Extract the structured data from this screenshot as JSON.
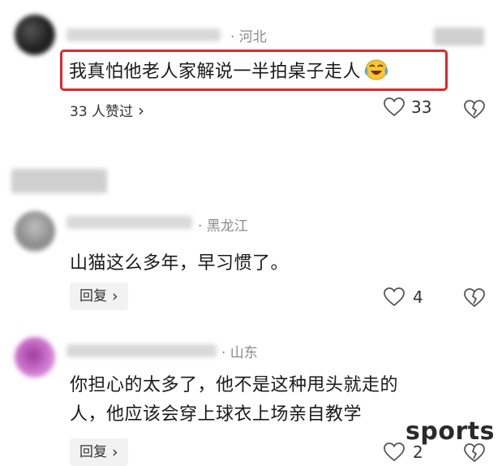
{
  "comments": [
    {
      "location": "· 河北",
      "text": "我真怕他老人家解说一半拍桌子走人",
      "emoji_icon": "laughing-crying-emoji-icon",
      "likers_label": "33 人赞过",
      "likers_chevron": "›",
      "like_count": "33",
      "highlight_color": "#e0262b"
    },
    {
      "location": "· 黑龙江",
      "text": "山猫这么多年，早习惯了。",
      "reply_label": "回复",
      "reply_chevron": "›",
      "like_count": "4"
    },
    {
      "location": "· 山东",
      "text_line1": "你担心的太多了，他不是这种甩头就走的",
      "text_line2": "人，他应该会穿上球衣上场亲自教学",
      "reply_label": "回复",
      "reply_chevron": "›",
      "like_count": "2"
    }
  ],
  "watermark": "sports"
}
